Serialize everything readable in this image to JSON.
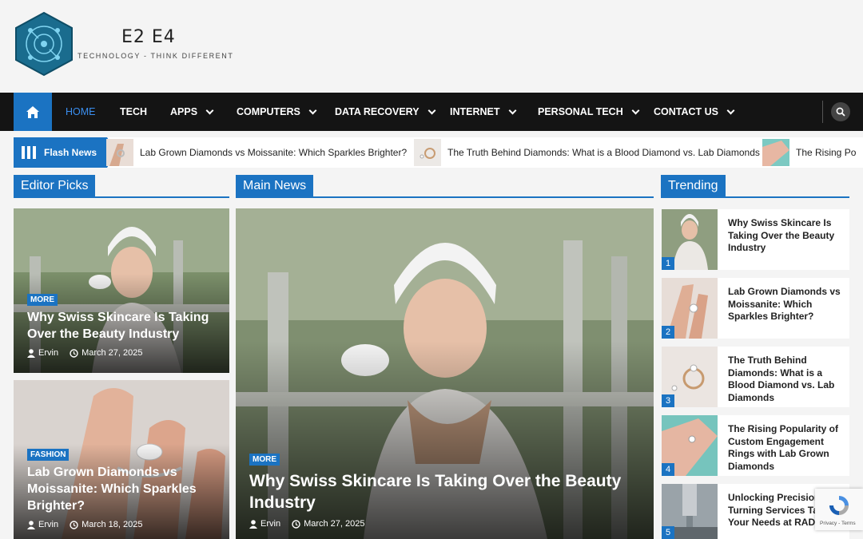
{
  "site": {
    "title": "E2 E4",
    "tagline": "TECHNOLOGY - THINK DIFFERENT"
  },
  "nav": {
    "items": [
      {
        "label": "HOME"
      },
      {
        "label": "TECH"
      },
      {
        "label": "APPS"
      },
      {
        "label": "COMPUTERS"
      },
      {
        "label": "DATA RECOVERY"
      },
      {
        "label": "INTERNET"
      },
      {
        "label": "PERSONAL TECH"
      },
      {
        "label": "CONTACT US"
      }
    ]
  },
  "flash": {
    "label": "Flash News",
    "items": [
      {
        "title": "Lab Grown Diamonds vs Moissanite: Which Sparkles Brighter?"
      },
      {
        "title": "The Truth Behind Diamonds: What is a Blood Diamond vs. Lab Diamonds"
      },
      {
        "title": "The Rising Po"
      }
    ]
  },
  "sections": {
    "editor_picks": "Editor Picks",
    "main_news": "Main News",
    "trending": "Trending"
  },
  "editor_picks": [
    {
      "category": "MORE",
      "title": "Why Swiss Skincare Is Taking Over the Beauty Industry",
      "author": "Ervin",
      "date": "March 27, 2025"
    },
    {
      "category": "FASHION",
      "title": "Lab Grown Diamonds vs Moissanite: Which Sparkles Brighter?",
      "author": "Ervin",
      "date": "March 18, 2025"
    }
  ],
  "main_news": {
    "category": "MORE",
    "title": "Why Swiss Skincare Is Taking Over the Beauty Industry",
    "author": "Ervin",
    "date": "March 27, 2025"
  },
  "trending": [
    {
      "num": "1",
      "title": "Why Swiss Skincare Is Taking Over the Beauty Industry"
    },
    {
      "num": "2",
      "title": "Lab Grown Diamonds vs Moissanite: Which Sparkles Brighter?"
    },
    {
      "num": "3",
      "title": "The Truth Behind Diamonds: What is a Blood Diamond vs. Lab Diamonds"
    },
    {
      "num": "4",
      "title": "The Rising Popularity of Custom Engagement Rings with Lab Grown Diamonds"
    },
    {
      "num": "5",
      "title": "Unlocking Precision: Turning Services Tailo Your Needs at RADMO"
    }
  ],
  "recaptcha": {
    "terms": "Privacy - Terms"
  }
}
